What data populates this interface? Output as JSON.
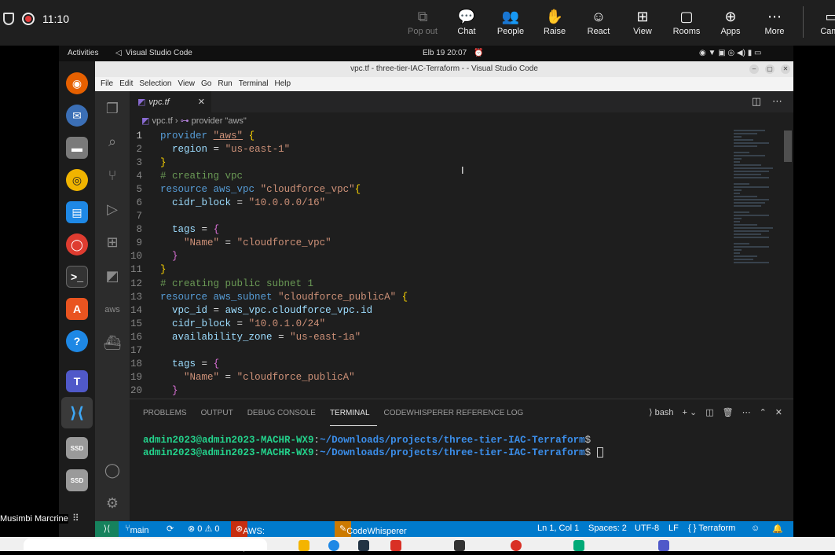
{
  "meet": {
    "time": "11:10",
    "actions": [
      {
        "label": "Pop out",
        "icon": "popout-icon",
        "disabled": true
      },
      {
        "label": "Chat",
        "icon": "chat-icon"
      },
      {
        "label": "People",
        "icon": "people-icon"
      },
      {
        "label": "Raise",
        "icon": "raise-hand-icon"
      },
      {
        "label": "React",
        "icon": "react-icon"
      },
      {
        "label": "View",
        "icon": "view-icon"
      },
      {
        "label": "Rooms",
        "icon": "rooms-icon"
      },
      {
        "label": "Apps",
        "icon": "apps-icon"
      },
      {
        "label": "More",
        "icon": "more-icon"
      },
      {
        "label": "Came",
        "icon": "camera-icon"
      }
    ],
    "participant": "Musimbi Marcrine"
  },
  "gnome": {
    "activities": "Activities",
    "app": "Visual Studio Code",
    "clock": "Elb 19  20:07"
  },
  "window": {
    "title": "vpc.tf - three-tier-IAC-Terraform - - Visual Studio Code",
    "menu": [
      "File",
      "Edit",
      "Selection",
      "View",
      "Go",
      "Run",
      "Terminal",
      "Help"
    ]
  },
  "editor": {
    "tab": "vpc.tf",
    "breadcrumb_file": "vpc.tf",
    "breadcrumb_symbol": "provider \"aws\""
  },
  "panel": {
    "tabs": [
      "PROBLEMS",
      "OUTPUT",
      "DEBUG CONSOLE",
      "TERMINAL",
      "CODEWHISPERER REFERENCE LOG"
    ],
    "active_tab": "TERMINAL",
    "shell": "bash",
    "terminal_lines": [
      {
        "user": "admin2023@admin2023-MACHR-WX9",
        "path": "~/Downloads/projects/three-tier-IAC-Terraform",
        "prompt": "$"
      },
      {
        "user": "admin2023@admin2023-MACHR-WX9",
        "path": "~/Downloads/projects/three-tier-IAC-Terraform",
        "prompt": "$"
      }
    ]
  },
  "status": {
    "branch": "main",
    "problems": "⊗ 0 ⚠ 0",
    "aws": "AWS: profile:default",
    "codewhisperer": "CodeWhisperer",
    "position": "Ln 1, Col 1",
    "spaces": "Spaces: 2",
    "encoding": "UTF-8",
    "eol": "LF",
    "language": "{ } Terraform"
  },
  "colors": {
    "statusbar": "#007acc",
    "editor_bg": "#1e1e1e",
    "string": "#ce9178",
    "keyword": "#569cd6",
    "comment": "#6a9955"
  }
}
